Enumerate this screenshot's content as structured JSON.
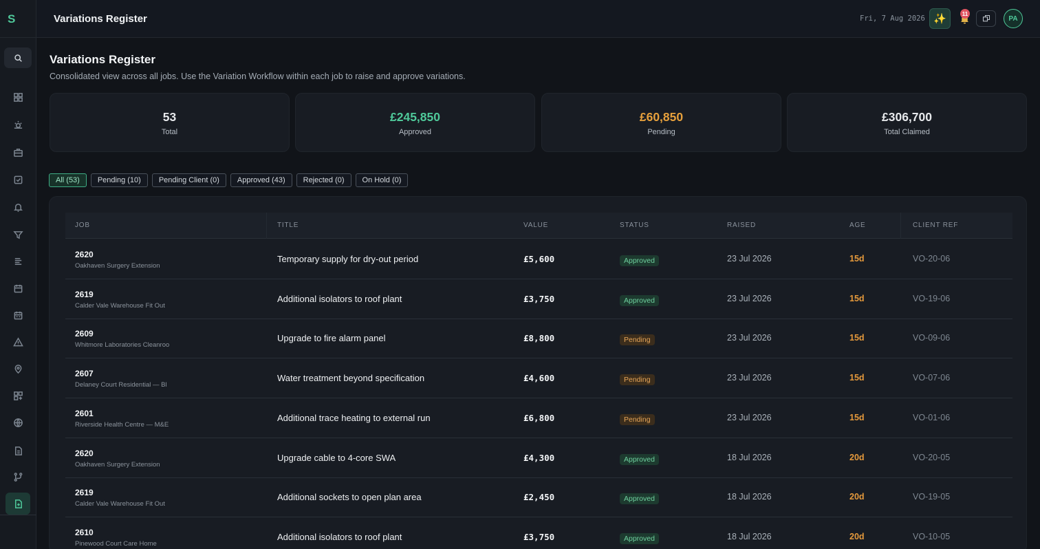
{
  "app": {
    "logo": "S"
  },
  "header": {
    "title": "Variations Register",
    "date": "Fri, 7 Aug 2026",
    "notification_count": "11",
    "avatar_initials": "PA"
  },
  "page": {
    "title": "Variations Register",
    "subtitle": "Consolidated view across all jobs. Use the Variation Workflow within each job to raise and approve variations."
  },
  "stats": [
    {
      "value": "53",
      "label": "Total",
      "color": "#f3f5f7"
    },
    {
      "value": "£245,850",
      "label": "Approved",
      "color": "#4fc99a"
    },
    {
      "value": "£60,850",
      "label": "Pending",
      "color": "#e6a03c"
    },
    {
      "value": "£306,700",
      "label": "Total Claimed",
      "color": "#f3f5f7"
    }
  ],
  "filters": [
    {
      "label": "All (53)",
      "active": true
    },
    {
      "label": "Pending (10)",
      "active": false
    },
    {
      "label": "Pending Client (0)",
      "active": false
    },
    {
      "label": "Approved (43)",
      "active": false
    },
    {
      "label": "Rejected (0)",
      "active": false
    },
    {
      "label": "On Hold (0)",
      "active": false
    }
  ],
  "table": {
    "columns": [
      "JOB",
      "TITLE",
      "VALUE",
      "STATUS",
      "RAISED",
      "AGE",
      "CLIENT REF"
    ],
    "rows": [
      {
        "job": "2620",
        "job_name": "Oakhaven Surgery Extension",
        "title": "Temporary supply for dry-out period",
        "value": "£5,600",
        "status": "Approved",
        "raised": "23 Jul 2026",
        "age": "15d",
        "ref": "VO-20-06"
      },
      {
        "job": "2619",
        "job_name": "Calder Vale Warehouse Fit Out",
        "title": "Additional isolators to roof plant",
        "value": "£3,750",
        "status": "Approved",
        "raised": "23 Jul 2026",
        "age": "15d",
        "ref": "VO-19-06"
      },
      {
        "job": "2609",
        "job_name": "Whitmore Laboratories Cleanroo",
        "title": "Upgrade to fire alarm panel",
        "value": "£8,800",
        "status": "Pending",
        "raised": "23 Jul 2026",
        "age": "15d",
        "ref": "VO-09-06"
      },
      {
        "job": "2607",
        "job_name": "Delaney Court Residential — Bl",
        "title": "Water treatment beyond specification",
        "value": "£4,600",
        "status": "Pending",
        "raised": "23 Jul 2026",
        "age": "15d",
        "ref": "VO-07-06"
      },
      {
        "job": "2601",
        "job_name": "Riverside Health Centre — M&E",
        "title": "Additional trace heating to external run",
        "value": "£6,800",
        "status": "Pending",
        "raised": "23 Jul 2026",
        "age": "15d",
        "ref": "VO-01-06"
      },
      {
        "job": "2620",
        "job_name": "Oakhaven Surgery Extension",
        "title": "Upgrade cable to 4-core SWA",
        "value": "£4,300",
        "status": "Approved",
        "raised": "18 Jul 2026",
        "age": "20d",
        "ref": "VO-20-05"
      },
      {
        "job": "2619",
        "job_name": "Calder Vale Warehouse Fit Out",
        "title": "Additional sockets to open plan area",
        "value": "£2,450",
        "status": "Approved",
        "raised": "18 Jul 2026",
        "age": "20d",
        "ref": "VO-19-05"
      },
      {
        "job": "2610",
        "job_name": "Pinewood Court Care Home",
        "title": "Additional isolators to roof plant",
        "value": "£3,750",
        "status": "Approved",
        "raised": "18 Jul 2026",
        "age": "20d",
        "ref": "VO-10-05"
      }
    ]
  },
  "sidebar_icons": [
    "dashboard-icon",
    "sun-icon",
    "briefcase-icon",
    "checklist-icon",
    "bell-icon",
    "filter-icon",
    "report-icon",
    "calendar-icon",
    "calendar-alt-icon",
    "warning-icon",
    "location-icon",
    "grid-plus-icon",
    "globe-icon",
    "document-icon",
    "workflow-icon",
    "variation-doc-icon"
  ]
}
